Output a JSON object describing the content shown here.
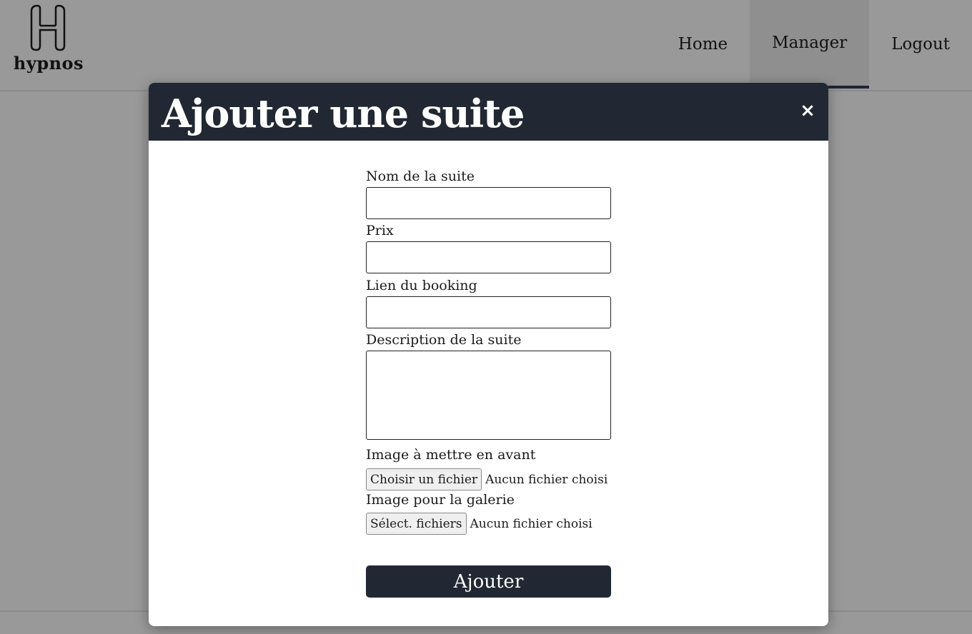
{
  "brand": {
    "name": "hypnos"
  },
  "nav": {
    "home": "Home",
    "manager": "Manager",
    "logout": "Logout"
  },
  "modal": {
    "title": "Ajouter une suite",
    "close": "×"
  },
  "form": {
    "name_label": "Nom de la suite",
    "name_value": "",
    "price_label": "Prix",
    "price_value": "",
    "booking_label": "Lien du booking",
    "booking_value": "",
    "description_label": "Description de la suite",
    "description_value": "",
    "featured_image_label": "Image à mettre en avant",
    "featured_image_button": "Choisir un fichier",
    "featured_image_status": "Aucun fichier choisi",
    "gallery_label": "Image pour la galerie",
    "gallery_button": "Sélect. fichiers",
    "gallery_status": "Aucun fichier choisi",
    "submit_label": "Ajouter"
  },
  "colors": {
    "overlay": "#999999",
    "modal_header": "#212833",
    "submit_button": "#212833",
    "active_nav_underline": "#1f2530"
  }
}
